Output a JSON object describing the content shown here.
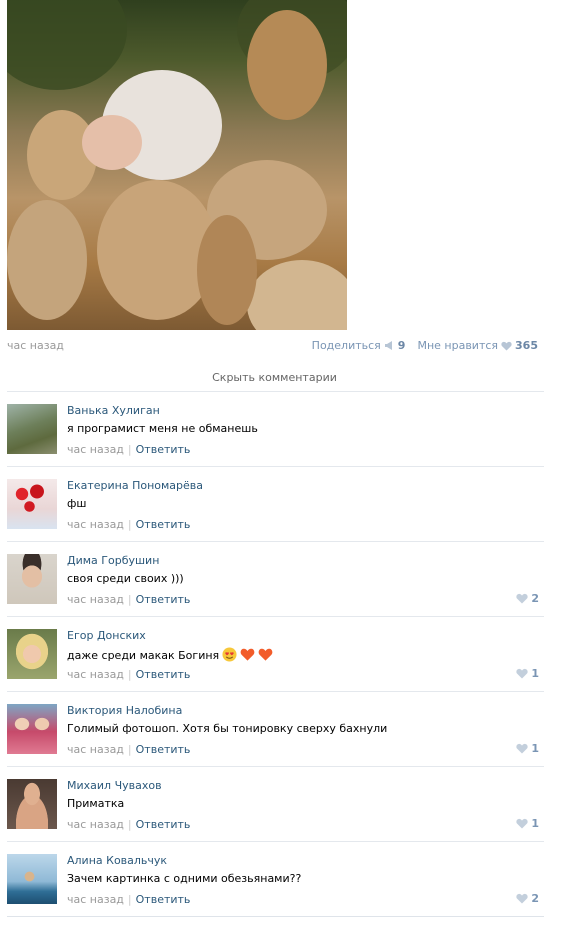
{
  "post": {
    "time": "час назад",
    "share_label": "Поделиться",
    "share_count": "9",
    "like_label": "Мне нравится",
    "like_count": "365"
  },
  "hide_comments": "Скрыть комментарии",
  "comments": [
    {
      "author": "Ванька Хулиган",
      "text": "я програмист меня не обманешь",
      "time": "час назад",
      "reply": "Ответить",
      "likes": ""
    },
    {
      "author": "Екатерина Пономарёва",
      "text": "фш",
      "time": "час назад",
      "reply": "Ответить",
      "likes": ""
    },
    {
      "author": "Дима Горбушин",
      "text": "своя среди своих )))",
      "time": "час назад",
      "reply": "Ответить",
      "likes": "2"
    },
    {
      "author": "Егор Донских",
      "text": "даже среди макак Богиня",
      "time": "час назад",
      "reply": "Ответить",
      "likes": "1"
    },
    {
      "author": "Виктория Налобина",
      "text": "Голимый фотошоп. Хотя бы тонировку сверху бахнули",
      "time": "час назад",
      "reply": "Ответить",
      "likes": "1"
    },
    {
      "author": "Михаил Чувахов",
      "text": "Приматка",
      "time": "час назад",
      "reply": "Ответить",
      "likes": "1"
    },
    {
      "author": "Алина Ковальчук",
      "text": "Зачем картинка с одними обезьянами??",
      "time": "час назад",
      "reply": "Ответить",
      "likes": "2"
    }
  ],
  "colors": {
    "link": "#2b587a",
    "muted": "#999999",
    "like": "#7a95b4"
  }
}
